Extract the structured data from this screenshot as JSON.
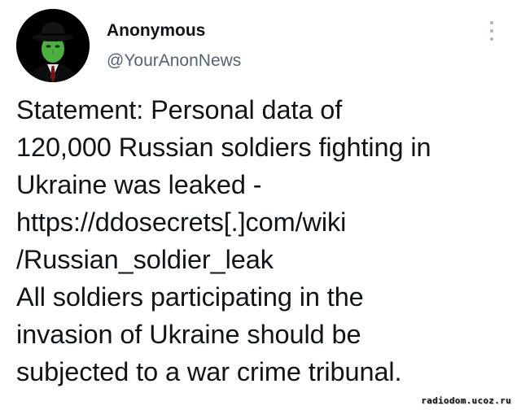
{
  "author": {
    "display_name": "Anonymous",
    "handle": "@YourAnonNews",
    "avatar_icon": "anonymous-mask-avatar"
  },
  "menu": {
    "icon": "more-vertical-icon"
  },
  "tweet": {
    "lines": [
      "Statement: Personal data of",
      "120,000 Russian soldiers fighting in",
      "Ukraine was leaked -",
      "https://ddosecrets[.]com/wiki",
      "/Russian_soldier_leak",
      "All soldiers participating in the",
      "invasion of Ukraine should be",
      "subjected to a war crime tribunal."
    ]
  },
  "watermark": "radiodom.ucoz.ru",
  "colors": {
    "text": "#0f1419",
    "secondary_text": "#536471",
    "avatar_bg": "#000000",
    "mask_green": "#4caf3f",
    "menu_dots": "#a6b4c1"
  }
}
